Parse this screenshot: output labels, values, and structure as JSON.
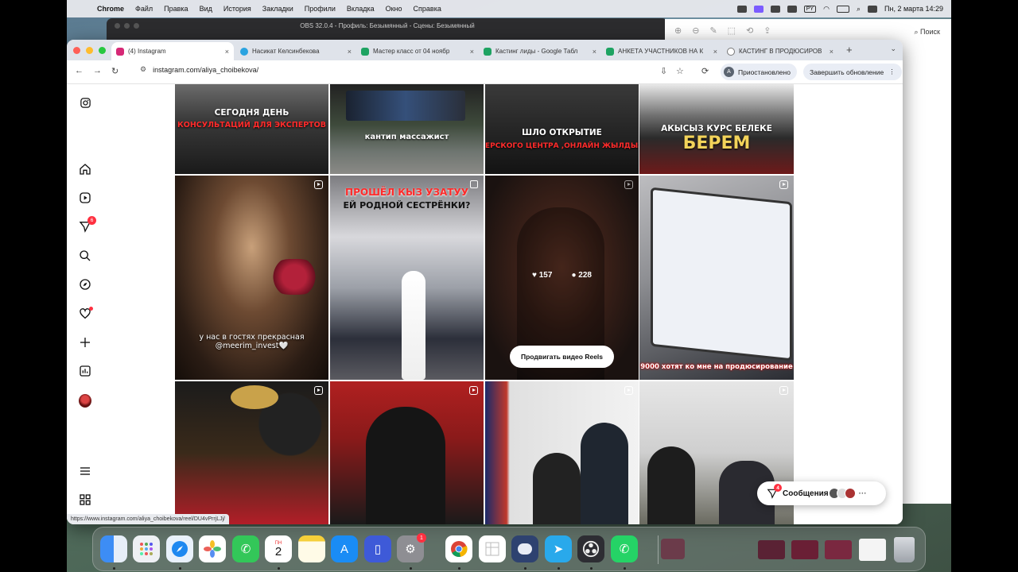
{
  "menubar": {
    "app": "Chrome",
    "items": [
      "Файл",
      "Правка",
      "Вид",
      "История",
      "Закладки",
      "Профили",
      "Вкладка",
      "Окно",
      "Справка"
    ],
    "lang": "PY",
    "datetime": "Пн, 2 марта  14:29"
  },
  "obs": {
    "title": "OBS 32.0.4 - Профиль: Безымянный - Сцены: Безымянный"
  },
  "other_window": {
    "search_label": "Поиск"
  },
  "tabs": [
    {
      "label": "(4) Instagram",
      "fav_color": "#d62976"
    },
    {
      "label": "Насикат Келсинбекова",
      "fav_color": "#2aa3e0"
    },
    {
      "label": "Мастер класс от 04 ноябр",
      "fav_color": "#1ea362"
    },
    {
      "label": "Кастинг лиды - Google Табл",
      "fav_color": "#1ea362"
    },
    {
      "label": "АНКЕТА УЧАСТНИКОВ НА К",
      "fav_color": "#1ea362"
    },
    {
      "label": "КАСТИНГ В ПРОДЮСИРОВ",
      "fav_color": "#777777"
    }
  ],
  "toolbar": {
    "url": "instagram.com/aliya_choibekova/",
    "profile_initial": "А",
    "paused_label": "Приостановлено",
    "update_label": "Завершить обновление"
  },
  "sidebar": {
    "notifications_badge": "6"
  },
  "posts": [
    {
      "caption_white": "СЕГОДНЯ ДЕНЬ",
      "caption_red": "КОНСУЛЬТАЦИЙ ДЛЯ ЭКСПЕРТОВ"
    },
    {
      "caption_white": "кантип массажист"
    },
    {
      "caption_white": "ШЛО ОТКРЫТИЕ",
      "caption_red": "ЕРСКОГО ЦЕНТРА ,ОНЛАЙН ЖЫЛДЫЗ"
    },
    {
      "caption_white": "АКЫСЫЗ КУРС БЕЛЕКЕ",
      "caption_yellow": "БЕРЕМ"
    },
    {
      "caption_white": "у нас в гостях прекрасная @meerim_invest🤍"
    },
    {
      "caption_red": "ПРОШЁЛ КЫЗ УЗАТУУ",
      "caption_white": "ЕЙ РОДНОЙ СЕСТРЁНКИ?"
    },
    {
      "likes": "157",
      "comments": "228",
      "promote_label": "Продвигать видео Reels"
    },
    {
      "caption_white": "9000 хотят ко мне на продюсирование"
    },
    {},
    {},
    {},
    {}
  ],
  "status_url": "https://www.instagram.com/aliya_choibekova/reel/DU4vPrrjLJj/",
  "messages": {
    "label": "Сообщения",
    "badge": "4"
  },
  "dock": {
    "calendar_month": "ПН",
    "calendar_day": "2",
    "settings_badge": "1"
  }
}
